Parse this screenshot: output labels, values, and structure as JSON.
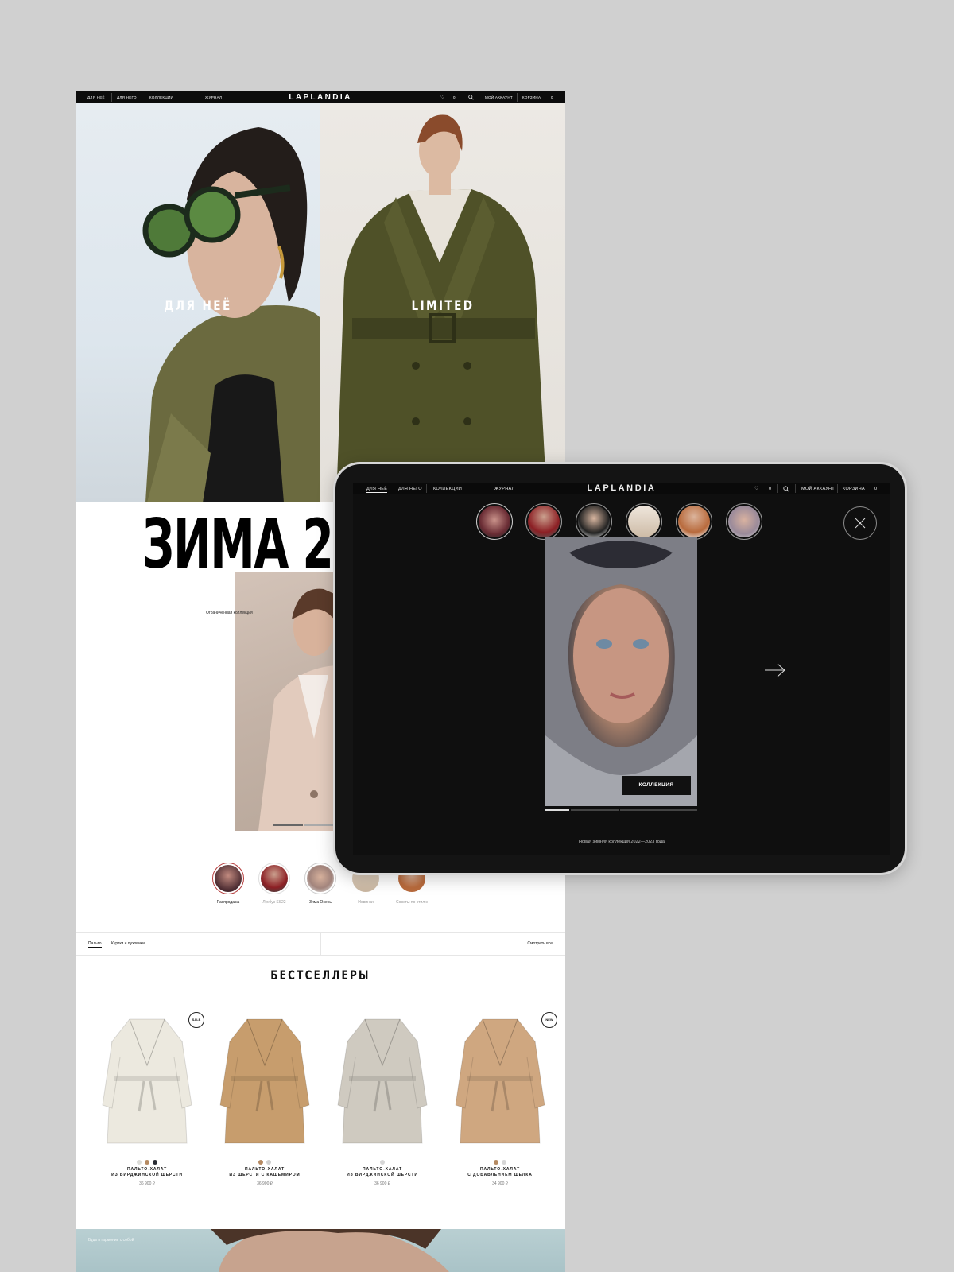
{
  "desktop": {
    "nav": {
      "left_links": [
        "ДЛЯ НЕЁ",
        "ДЛЯ НЕГО",
        "КОЛЛЕКЦИИ",
        "ЖУРНАЛ"
      ],
      "logo": "LAPLANDIA",
      "wishlist_count": "0",
      "account": "МОЙ АККАУНТ",
      "cart": "КОРЗИНА",
      "cart_count": "0"
    },
    "hero": [
      {
        "caption": "ДЛЯ НЕЁ"
      },
      {
        "caption": "LIMITED"
      }
    ],
    "zima": {
      "title": "ЗИМА 2",
      "subtitle": "Ограниченная коллекция"
    },
    "stories": [
      {
        "label": "Распродажа"
      },
      {
        "label": "Лукбук SS22"
      },
      {
        "label": "Зима Осень"
      },
      {
        "label": "Новинки"
      },
      {
        "label": "Советы по стилю"
      }
    ],
    "filters": {
      "tabs": [
        "Пальто",
        "Куртки и пуховики"
      ],
      "see_all": "Смотреть все"
    },
    "bestsellers_title": "БЕСТСЕЛЛЕРЫ",
    "products": [
      {
        "name_line1": "ПАЛЬТО-ХАЛАТ",
        "name_line2": "ИЗ ВИРДЖИНСКОЙ ШЕРСТИ",
        "price": "36 900 ₽",
        "badge": "SALE",
        "swatches": [
          "#dcdcd8",
          "#b58a62",
          "#2a2d34"
        ],
        "coat_color": "#ece9df"
      },
      {
        "name_line1": "ПАЛЬТО-ХАЛАТ",
        "name_line2": "ИЗ ШЕРСТИ С КАШЕМИРОМ",
        "price": "36 900 ₽",
        "badge": "",
        "swatches": [
          "#b58a62",
          "#cfcfcf"
        ],
        "coat_color": "#c79d6d"
      },
      {
        "name_line1": "ПАЛЬТО-ХАЛАТ",
        "name_line2": "ИЗ ВИРДЖИНСКОЙ ШЕРСТИ",
        "price": "36 900 ₽",
        "badge": "",
        "swatches": [
          "#d6d6d6"
        ],
        "coat_color": "#cfcac0"
      },
      {
        "name_line1": "ПАЛЬТО-ХАЛАТ",
        "name_line2": "С ДОБАВЛЕНИЕМ ШЕЛКА",
        "price": "34 900 ₽",
        "badge": "NEW",
        "swatches": [
          "#b58a62",
          "#d6d6d6"
        ],
        "coat_color": "#cfa780"
      }
    ],
    "banner_text": "Будь в гармонии с собой"
  },
  "tablet": {
    "nav": {
      "left_links": [
        "ДЛЯ НЕЁ",
        "ДЛЯ НЕГО",
        "КОЛЛЕКЦИИ",
        "ЖУРНАЛ"
      ],
      "logo": "LAPLANDIA",
      "wishlist_count": "0",
      "account": "МОЙ АККАУНТ",
      "cart": "КОРЗИНА",
      "cart_count": "0"
    },
    "collection_button": "КОЛЛЕКЦИЯ",
    "caption": "Новая зимняя коллекция 2022—2023 года"
  }
}
